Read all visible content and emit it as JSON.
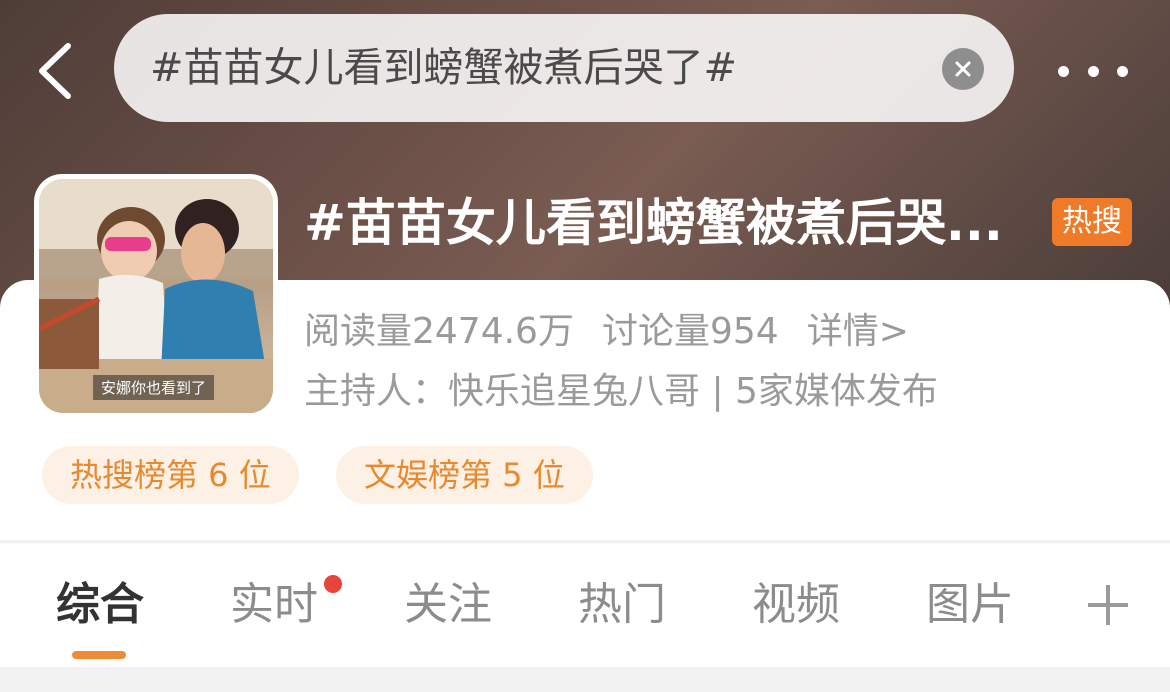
{
  "search": {
    "query": "#苗苗女儿看到螃蟹被煮后哭了#"
  },
  "topic": {
    "title": "#苗苗女儿看到螃蟹被煮后哭...",
    "hot_tag": "热搜",
    "cover_caption": "安娜你也看到了",
    "reads": "阅读量2474.6万",
    "discussions": "讨论量954",
    "details_link": "详情>",
    "host_line": "主持人：快乐追星兔八哥 | 5家媒体发布"
  },
  "ranks": {
    "hot_search": "热搜榜第 6 位",
    "entertainment": "文娱榜第 5 位"
  },
  "tabs": [
    {
      "label": "综合",
      "active": true
    },
    {
      "label": "实时",
      "has_dot": true
    },
    {
      "label": "关注"
    },
    {
      "label": "热门"
    },
    {
      "label": "视频"
    },
    {
      "label": "图片"
    }
  ],
  "colors": {
    "accent": "#f08a36",
    "hot_tag": "#ef7a28",
    "badge_dot": "#e8443a"
  }
}
